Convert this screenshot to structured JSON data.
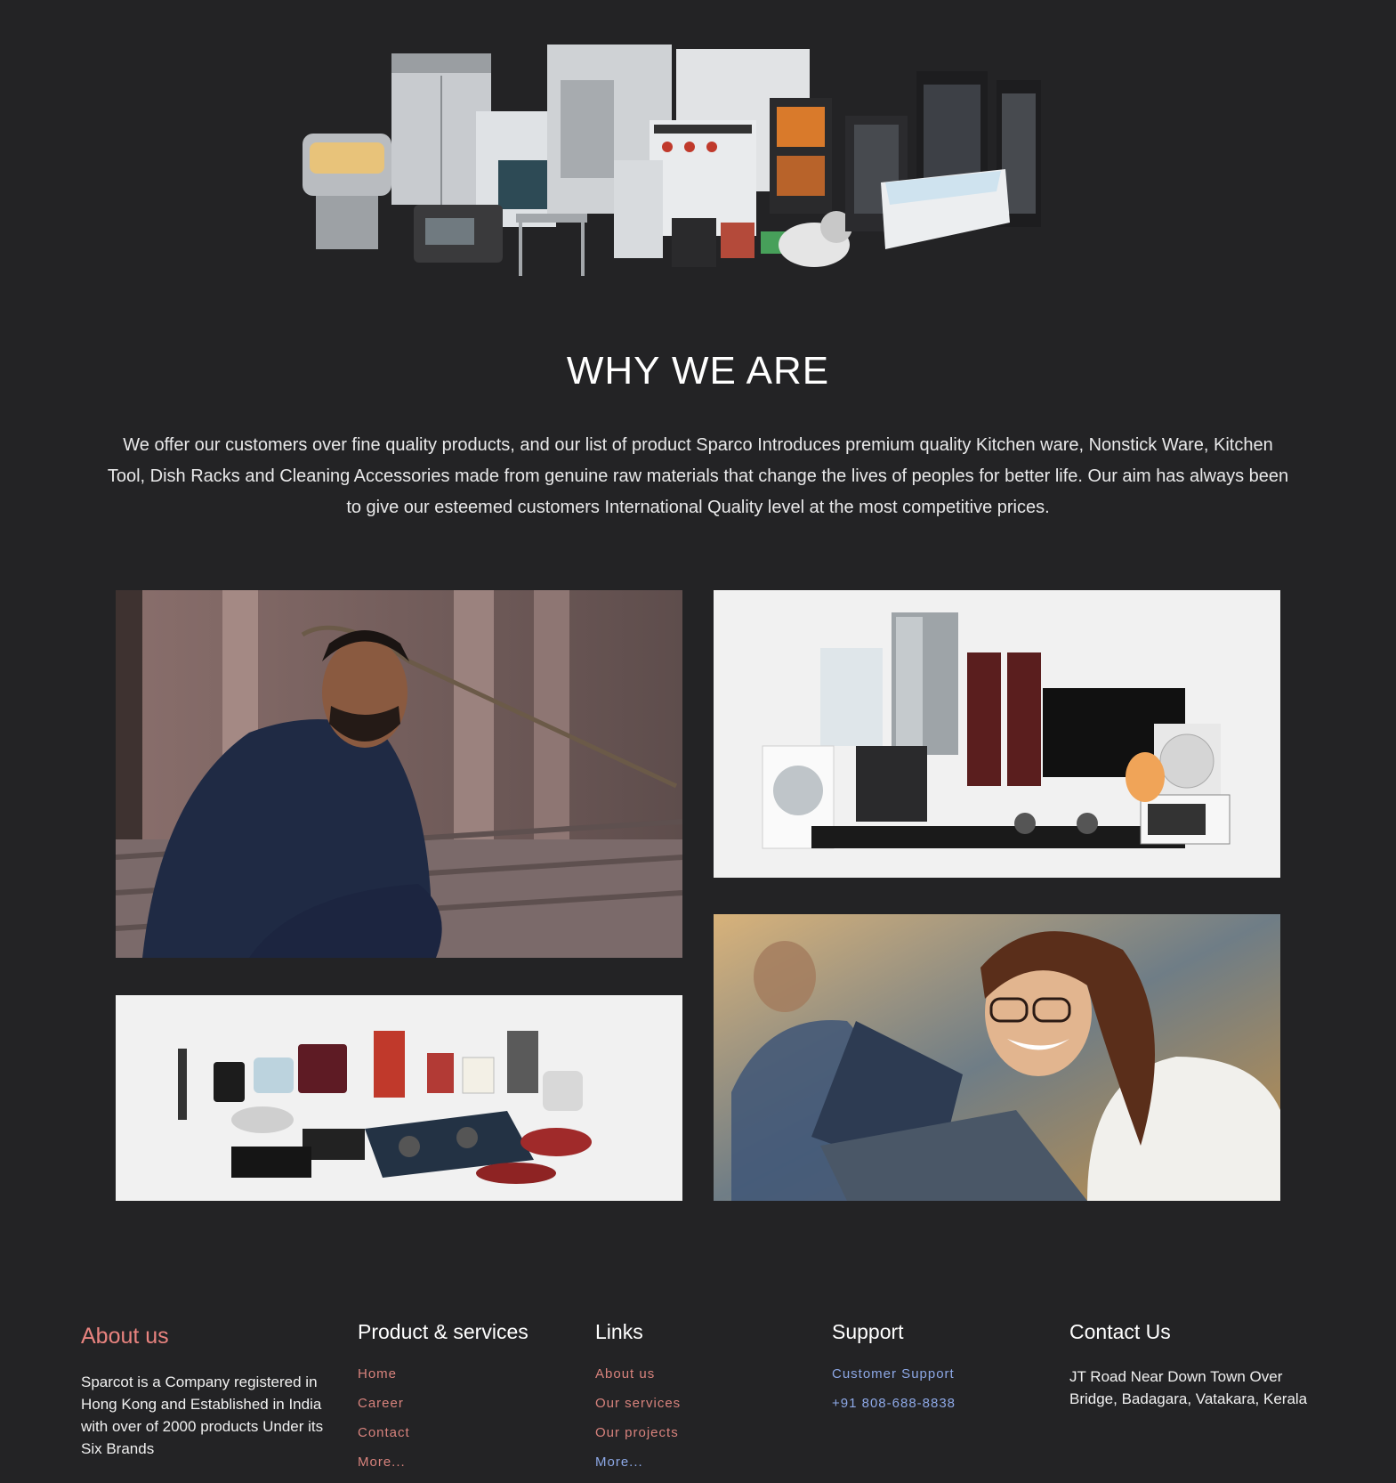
{
  "hero": {
    "image_icon": "commercial-kitchen-appliances-image",
    "colors": {
      "steel": "#c9ccd0",
      "steel_dark": "#8e9296",
      "black": "#1d1d1f",
      "accent_red": "#c0392b"
    }
  },
  "why_section": {
    "title": "WHY WE ARE",
    "body": "We offer our customers over fine quality products, and our list of product Sparco Introduces premium quality Kitchen ware, Nonstick Ware, Kitchen Tool, Dish Racks and Cleaning Accessories made from genuine raw materials that change the lives of peoples for better life. Our aim has always been to give our esteemed customers International Quality level at the most competitive prices."
  },
  "gallery": [
    {
      "icon": "smiling-man-photo"
    },
    {
      "icon": "home-appliances-photo"
    },
    {
      "icon": "kitchen-appliances-photo"
    },
    {
      "icon": "smiling-woman-laptop-photo"
    }
  ],
  "footer": {
    "about": {
      "heading": "About us",
      "text": "Sparcot is a Company registered in Hong Kong and Established in India with over of 2000 products Under its Six Brands"
    },
    "products": {
      "heading": "Product & services",
      "links": [
        "Home",
        "Career",
        "Contact",
        "More..."
      ]
    },
    "links": {
      "heading": "Links",
      "links": [
        "About us",
        "Our services",
        "Our projects",
        "More..."
      ]
    },
    "support": {
      "heading": "Support",
      "links": [
        "Customer Support",
        "+91 808-688-8838"
      ]
    },
    "contact": {
      "heading": "Contact Us",
      "address": "JT Road Near Down Town Over Bridge, Badagara, Vatakara, Kerala"
    },
    "colors": {
      "accent": "#e9837f",
      "link_coral": "#d9837d",
      "link_blue": "#8da8e6",
      "background": "#232325"
    }
  }
}
